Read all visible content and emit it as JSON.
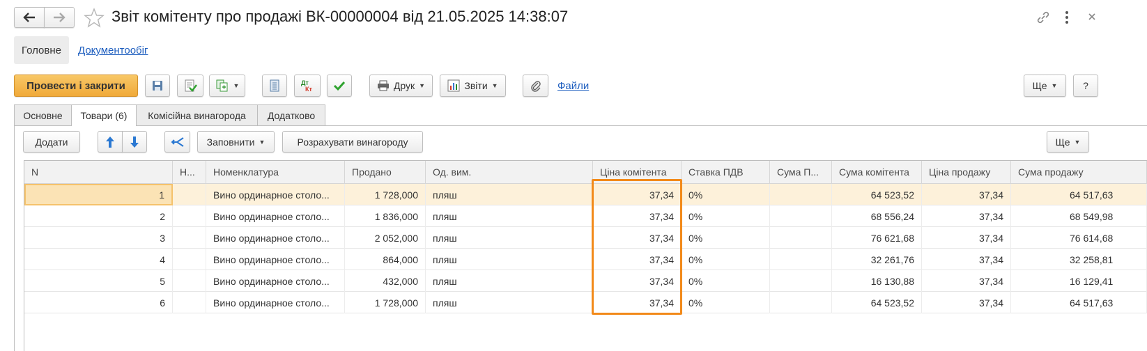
{
  "window": {
    "title": "Звіт комітенту про продажі ВК-00000004 від 21.05.2025 14:38:07"
  },
  "nav": {
    "main": "Головне",
    "docflow": "Документообіг"
  },
  "toolbar": {
    "post_close": "Провести і закрити",
    "print": "Друк",
    "reports": "Звіти",
    "files": "Файли",
    "more": "Ще",
    "help": "?"
  },
  "tabs": [
    "Основне",
    "Товари (6)",
    "Комісійна винагорода",
    "Додатково"
  ],
  "table_toolbar": {
    "add": "Додати",
    "fill": "Заповнити",
    "calc": "Розрахувати винагороду",
    "more": "Ще"
  },
  "table": {
    "columns": [
      "N",
      "Н...",
      "Номенклатура",
      "Продано",
      "Од. вим.",
      "Ціна комітента",
      "Ставка ПДВ",
      "Сума П...",
      "Сума комітента",
      "Ціна продажу",
      "Сума продажу"
    ],
    "rows": [
      [
        "1",
        "",
        "Вино ординарное столо...",
        "1 728,000",
        "пляш",
        "37,34",
        "0%",
        "",
        "64 523,52",
        "37,34",
        "64 517,63"
      ],
      [
        "2",
        "",
        "Вино ординарное столо...",
        "1 836,000",
        "пляш",
        "37,34",
        "0%",
        "",
        "68 556,24",
        "37,34",
        "68 549,98"
      ],
      [
        "3",
        "",
        "Вино ординарное столо...",
        "2 052,000",
        "пляш",
        "37,34",
        "0%",
        "",
        "76 621,68",
        "37,34",
        "76 614,68"
      ],
      [
        "4",
        "",
        "Вино ординарное столо...",
        "864,000",
        "пляш",
        "37,34",
        "0%",
        "",
        "32 261,76",
        "37,34",
        "32 258,81"
      ],
      [
        "5",
        "",
        "Вино ординарное столо...",
        "432,000",
        "пляш",
        "37,34",
        "0%",
        "",
        "16 130,88",
        "37,34",
        "16 129,41"
      ],
      [
        "6",
        "",
        "Вино ординарное столо...",
        "1 728,000",
        "пляш",
        "37,34",
        "0%",
        "",
        "64 523,52",
        "37,34",
        "64 517,63"
      ]
    ]
  },
  "colors": {
    "primary_button": "#f5b54a",
    "highlight": "#f28a1a",
    "link": "#1f5fbf",
    "selected_row": "#fdf1da"
  }
}
